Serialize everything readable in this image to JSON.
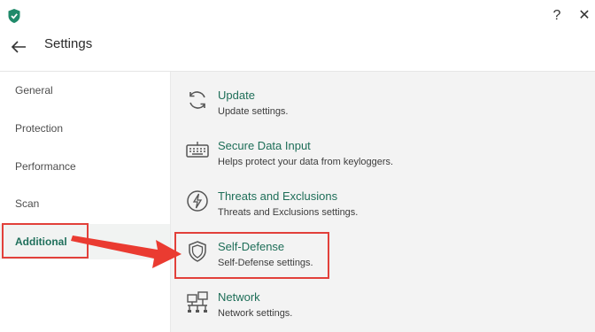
{
  "titlebar": {
    "help_label": "?",
    "close_label": "✕"
  },
  "header": {
    "back_icon": "arrow-left-icon",
    "title": "Settings"
  },
  "sidebar": {
    "items": [
      {
        "label": "General"
      },
      {
        "label": "Protection"
      },
      {
        "label": "Performance"
      },
      {
        "label": "Scan"
      },
      {
        "label": "Additional"
      }
    ],
    "selected": "Additional"
  },
  "content": {
    "items": [
      {
        "title": "Update",
        "desc": "Update settings.",
        "icon": "refresh-icon"
      },
      {
        "title": "Secure Data Input",
        "desc": "Helps protect your data from keyloggers.",
        "icon": "keyboard-icon"
      },
      {
        "title": "Threats and Exclusions",
        "desc": "Threats and Exclusions settings.",
        "icon": "lightning-icon"
      },
      {
        "title": "Self-Defense",
        "desc": "Self-Defense settings.",
        "icon": "shield-icon"
      },
      {
        "title": "Network",
        "desc": "Network settings.",
        "icon": "network-icon"
      }
    ]
  },
  "colors": {
    "accent": "#1e6e58",
    "highlight": "#e2403a",
    "panel_bg": "#f3f3f3"
  }
}
